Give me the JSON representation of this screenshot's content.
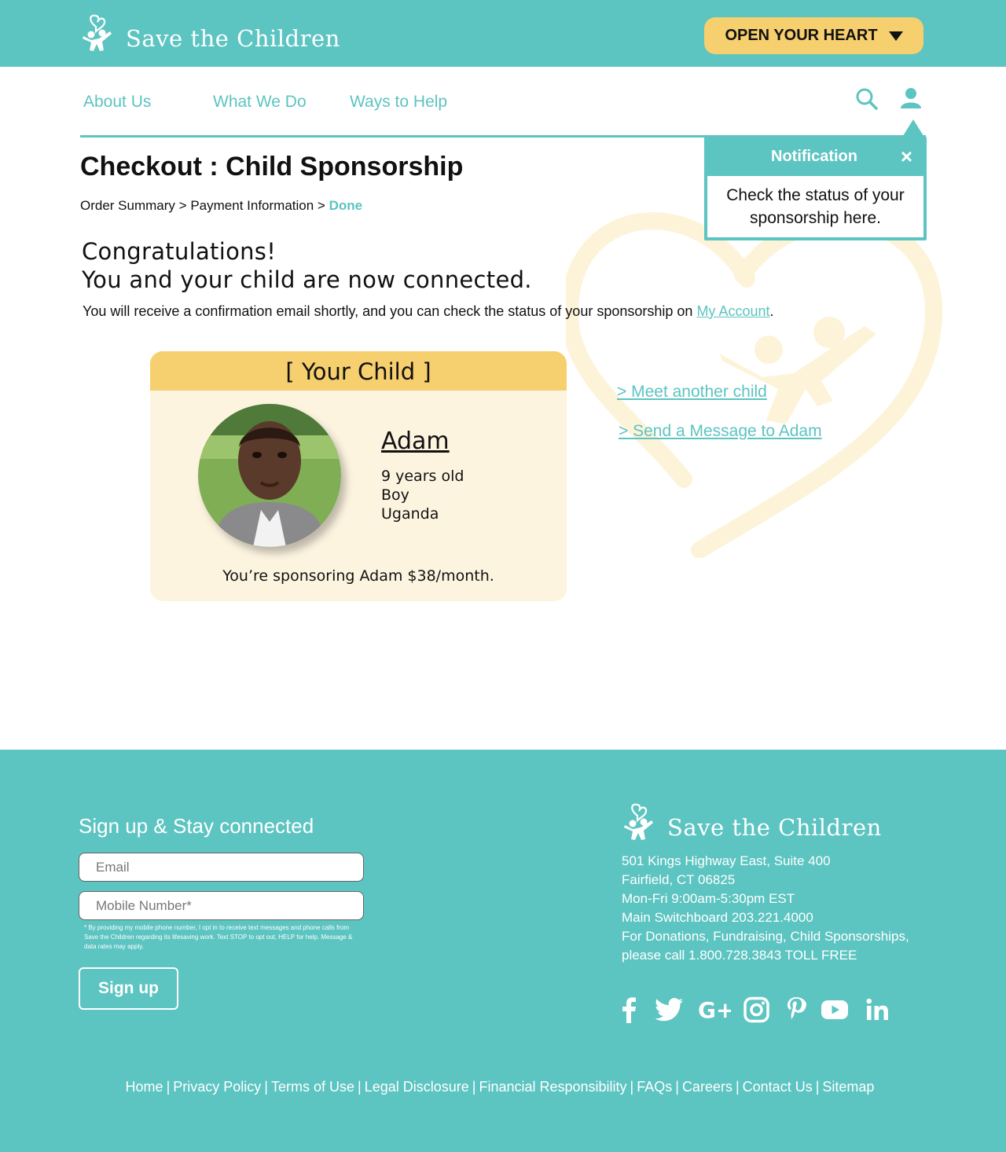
{
  "header": {
    "brand": "Save the Children",
    "cta_label": "OPEN YOUR HEART"
  },
  "nav": {
    "items": [
      "About Us",
      "What We Do",
      "Ways to Help"
    ]
  },
  "notification": {
    "title": "Notification",
    "close": "×",
    "body": "Check the status of your sponsorship here."
  },
  "checkout": {
    "title": "Checkout : Child Sponsorship",
    "crumb_1": "Order Summary",
    "crumb_sep": ">",
    "crumb_2": "Payment Information",
    "crumb_3": "Done",
    "congrats_line1": "Congratulations!",
    "congrats_line2": "You and your child are now connected.",
    "confirm_text": "You will receive a confirmation email shortly, and you can check the status of your sponsorship on",
    "confirm_link": "My Account",
    "confirm_end": "."
  },
  "child": {
    "card_title": "[ Your Child ]",
    "name": "Adam",
    "age": "9 years old",
    "gender": "Boy",
    "country": "Uganda",
    "sponsor_line": "You’re sponsoring Adam $38/month."
  },
  "actions": {
    "meet": "> Meet another child",
    "message": "> Send a Message to Adam"
  },
  "footer": {
    "signup_heading": "Sign up & Stay connected",
    "email_placeholder": "Email",
    "mobile_placeholder": "Mobile Number*",
    "fine_print": "* By providing my mobile phone number, I opt in to receive text messages and phone calls from Save the Children regarding its lifesaving work. Text STOP to opt out, HELP for help. Message & data rates may apply.",
    "signup_button": "Sign up",
    "brand": "Save the Children",
    "address_1": "501 Kings Highway East, Suite 400",
    "address_2": "Fairfield, CT 06825",
    "hours": "Mon-Fri 9:00am-5:30pm EST",
    "switchboard": "Main Switchboard 203.221.4000",
    "donations_1": "For Donations, Fundraising, Child Sponsorships,",
    "donations_2": "please call 1.800.728.3843 TOLL FREE",
    "social": [
      "facebook-icon",
      "twitter-icon",
      "google-plus-icon",
      "instagram-icon",
      "pinterest-icon",
      "youtube-icon",
      "linkedin-icon"
    ],
    "links": [
      "Home",
      "Privacy Policy",
      "Terms of Use",
      "Legal Disclosure",
      "Financial Responsibility",
      "FAQs",
      "Careers",
      "Contact Us",
      "Sitemap"
    ],
    "link_sep": "|"
  },
  "colors": {
    "teal": "#5cc4c1",
    "yellow": "#f6cf6e",
    "cream": "#fdf4e0"
  }
}
